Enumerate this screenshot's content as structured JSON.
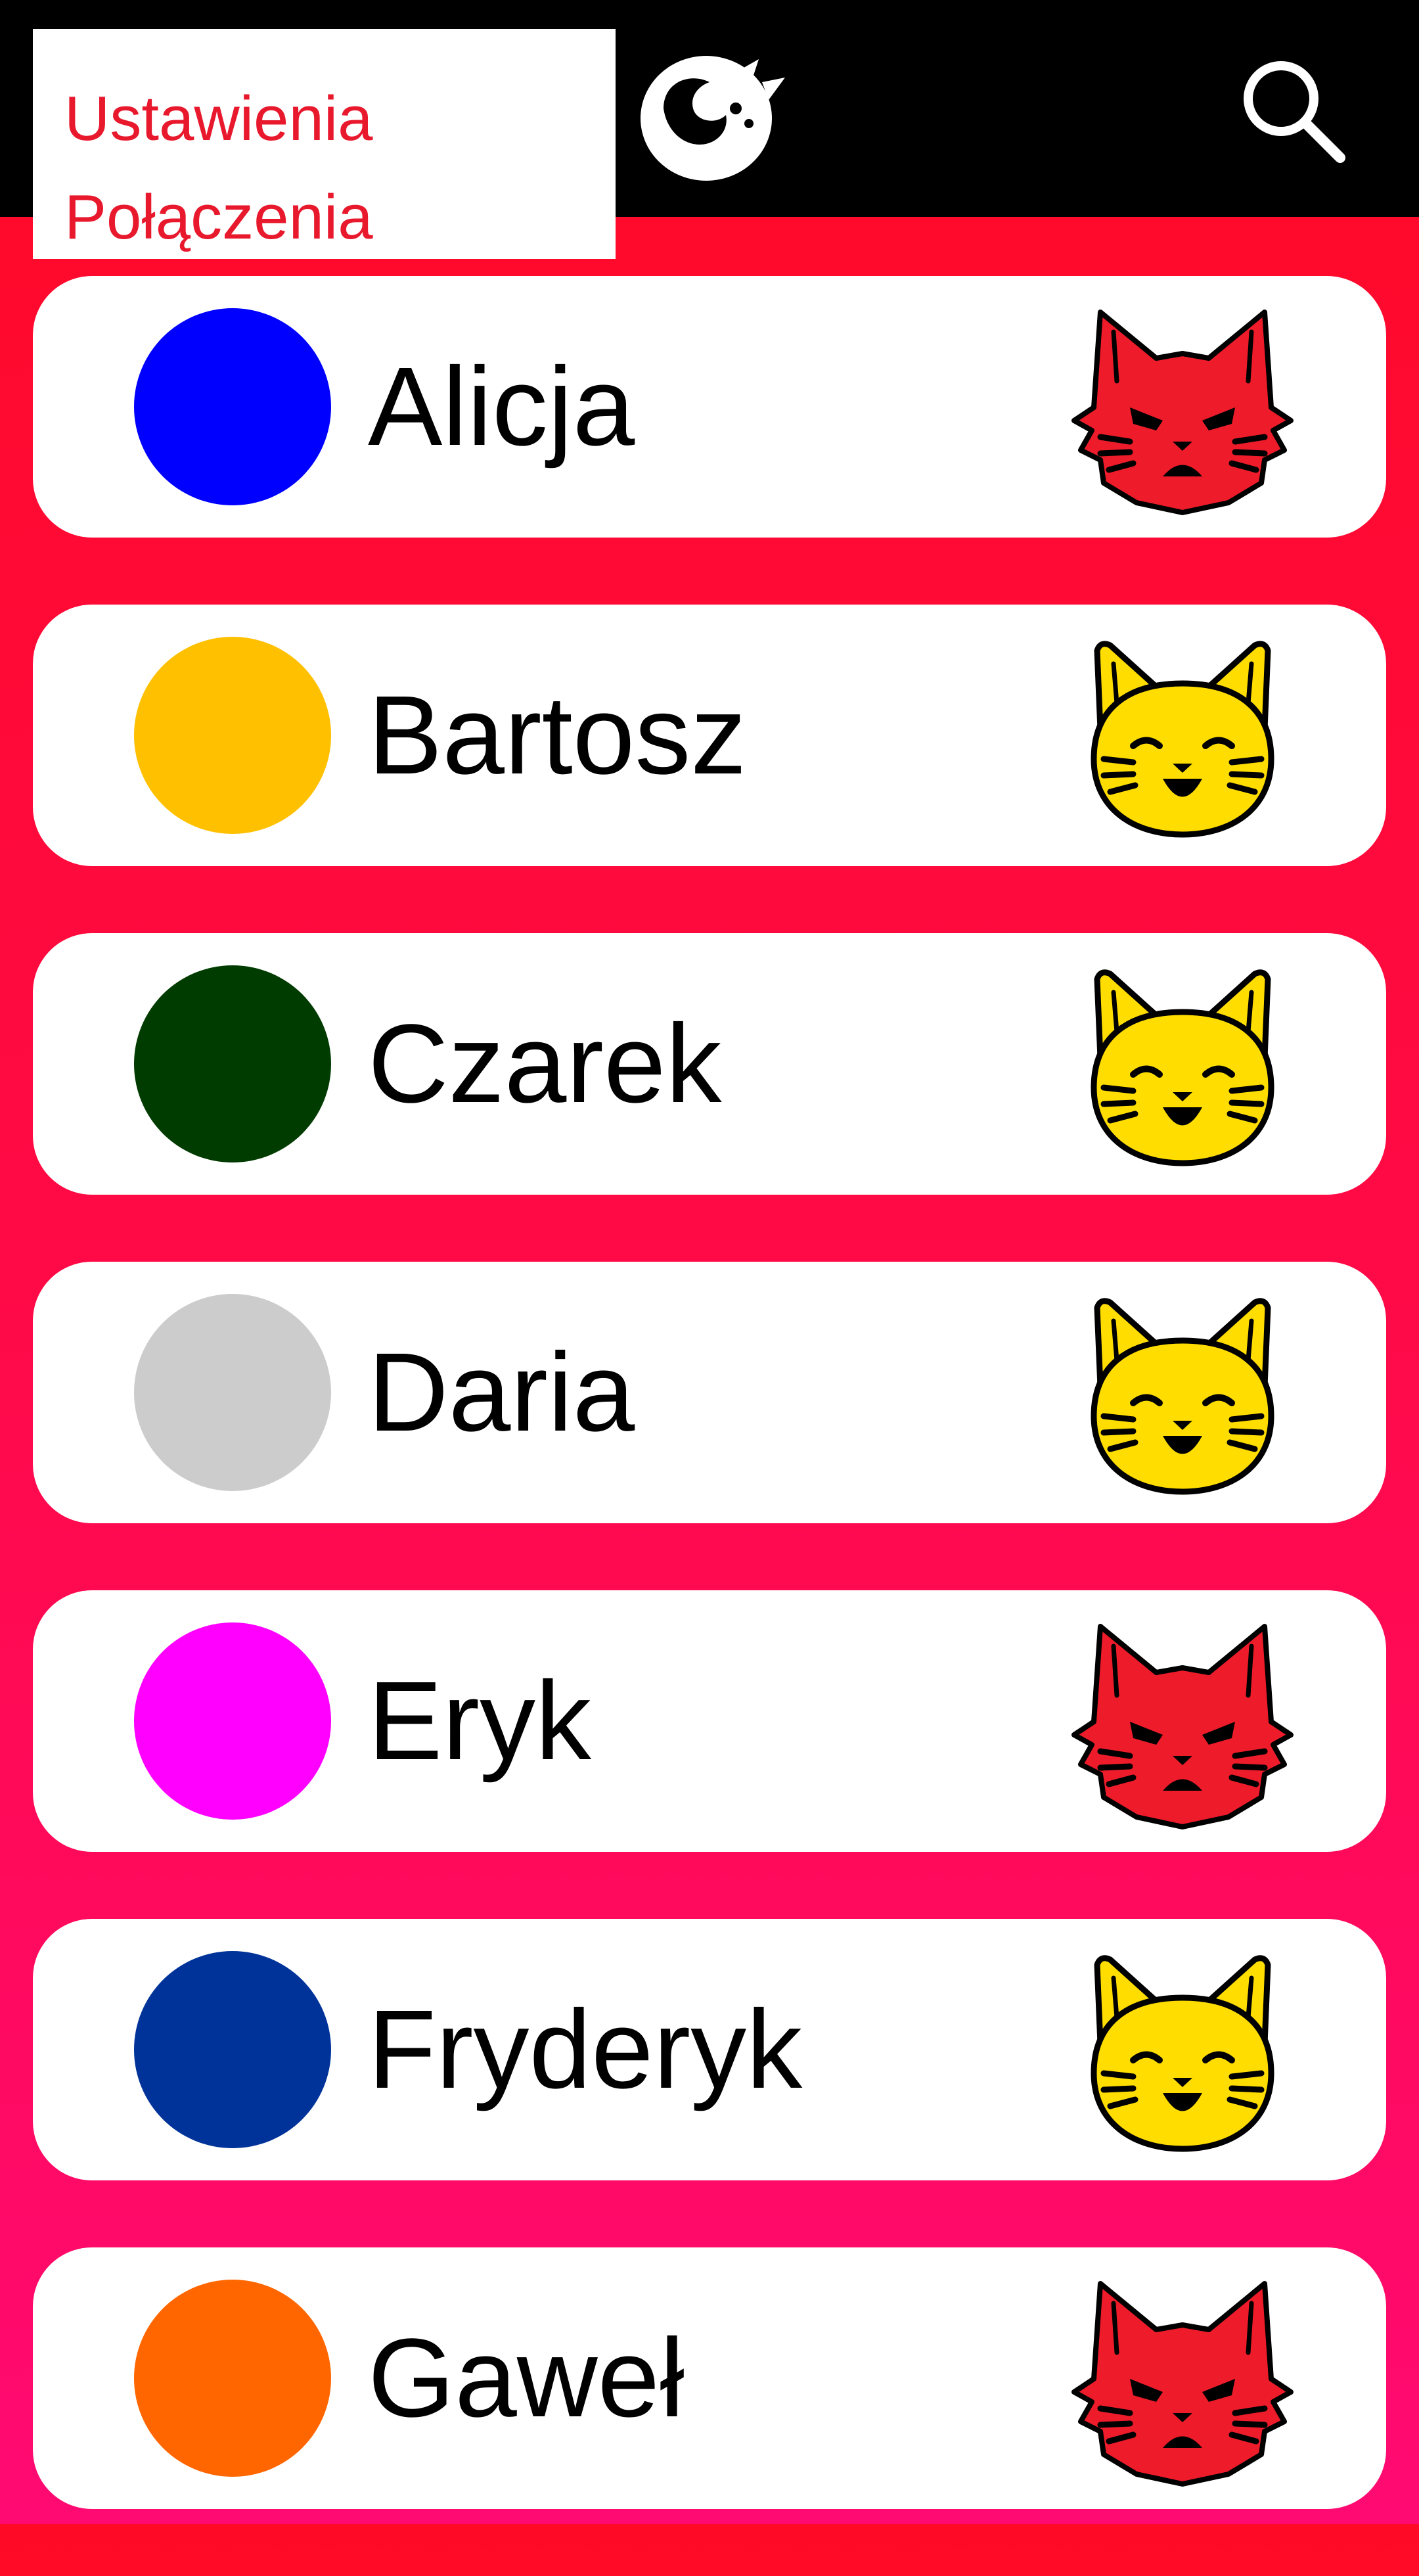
{
  "menu": {
    "settings_label": "Ustawienia",
    "connections_label": "Połączenia"
  },
  "header": {
    "logo_icon": "cat-curled-logo-icon",
    "search_icon": "search-icon"
  },
  "contacts": [
    {
      "name": "Alicja",
      "color": "#0000ff",
      "mood": "angry"
    },
    {
      "name": "Bartosz",
      "color": "#ffc000",
      "mood": "happy"
    },
    {
      "name": "Czarek",
      "color": "#003b00",
      "mood": "happy"
    },
    {
      "name": "Daria",
      "color": "#cccccc",
      "mood": "happy"
    },
    {
      "name": "Eryk",
      "color": "#ff00ff",
      "mood": "angry"
    },
    {
      "name": "Fryderyk",
      "color": "#003399",
      "mood": "happy"
    },
    {
      "name": "Gaweł",
      "color": "#ff6600",
      "mood": "angry"
    }
  ],
  "colors": {
    "menu_text": "#e8182d",
    "angry_cat": "#ee1c2a",
    "happy_cat": "#ffdd00",
    "topbar": "#000000"
  }
}
